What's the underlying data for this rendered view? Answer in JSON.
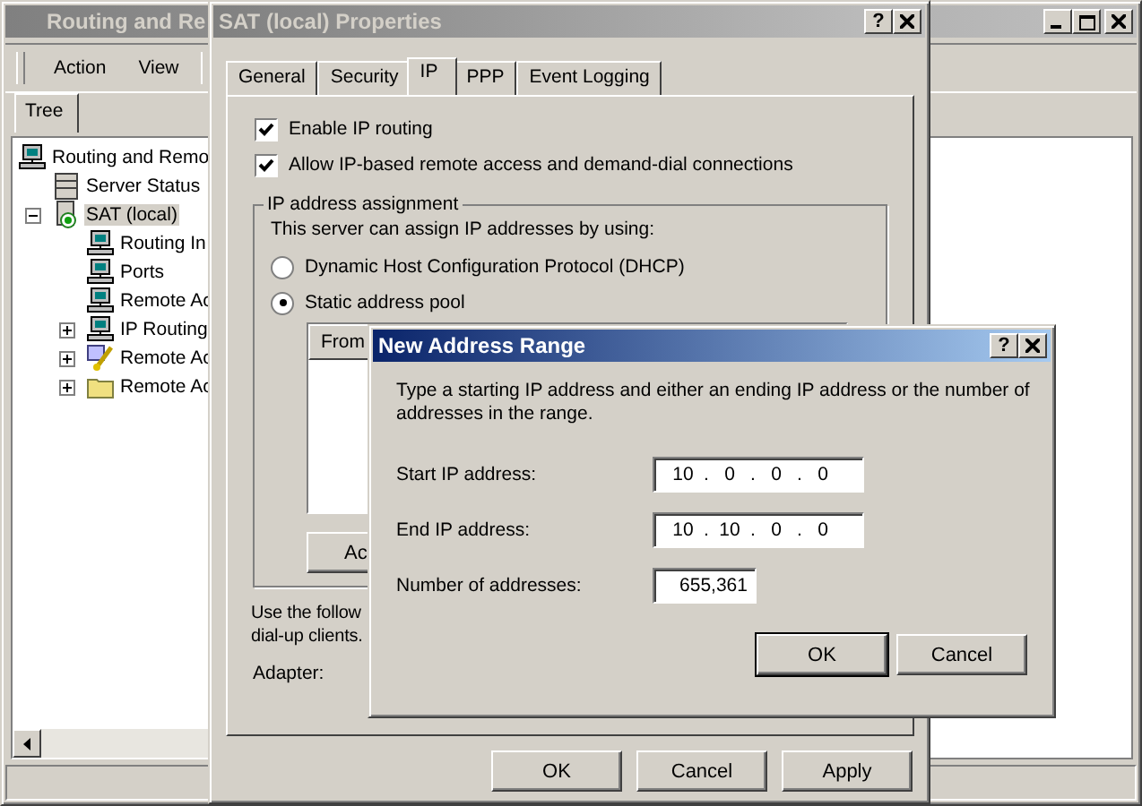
{
  "main_window": {
    "title": "Routing and Re",
    "menu": [
      "Action",
      "View"
    ],
    "tree_tab": "Tree",
    "tree": [
      {
        "label": "Routing and Remo",
        "kind": "computer",
        "children": [
          {
            "label": "Server Status",
            "kind": "server"
          },
          {
            "label": "SAT (local)",
            "kind": "sat",
            "selected": true,
            "expanded": true,
            "children": [
              {
                "label": "Routing In",
                "kind": "computer"
              },
              {
                "label": "Ports",
                "kind": "computer"
              },
              {
                "label": "Remote Ac",
                "kind": "computer"
              },
              {
                "label": "IP Routing",
                "kind": "computer",
                "expanded": false
              },
              {
                "label": "Remote Ac",
                "kind": "policy",
                "expanded": false
              },
              {
                "label": "Remote Ac",
                "kind": "folder",
                "expanded": false
              }
            ]
          }
        ]
      }
    ]
  },
  "properties": {
    "title": "SAT (local) Properties",
    "help_button": "?",
    "tabs": [
      {
        "label": "General",
        "selected": false
      },
      {
        "label": "Security",
        "selected": false
      },
      {
        "label": "IP",
        "selected": true
      },
      {
        "label": "PPP",
        "selected": false
      },
      {
        "label": "Event Logging",
        "selected": false
      }
    ],
    "checkboxes": [
      {
        "label": "Enable IP routing",
        "checked": true
      },
      {
        "label": "Allow IP-based remote access and demand-dial connections",
        "checked": true
      }
    ],
    "group": {
      "title": "IP address assignment",
      "text": "This server can assign IP addresses by using:",
      "radios": [
        {
          "label": "Dynamic Host Configuration Protocol (DHCP)",
          "selected": false
        },
        {
          "label": "Static address pool",
          "selected": true
        }
      ],
      "list_column": "From",
      "button": "Ac"
    },
    "note": [
      "Use the follow",
      "dial-up clients."
    ],
    "adapter_label": "Adapter:",
    "buttons": [
      "OK",
      "Cancel",
      "Apply"
    ]
  },
  "dialog": {
    "title": "New Address Range",
    "help_button": "?",
    "octet_separator": ".",
    "text": "Type a starting IP address and either an ending IP address or the number of addresses in the range.",
    "fields": [
      {
        "kind": "ip",
        "label": "Start IP address:",
        "octets": [
          "10",
          "0",
          "0",
          "0"
        ]
      },
      {
        "kind": "ip",
        "label": "End IP address:",
        "octets": [
          "10",
          "10",
          "0",
          "0"
        ]
      },
      {
        "kind": "number",
        "label": "Number of addresses:",
        "value": "655,361"
      }
    ],
    "buttons": [
      "OK",
      "Cancel"
    ]
  }
}
